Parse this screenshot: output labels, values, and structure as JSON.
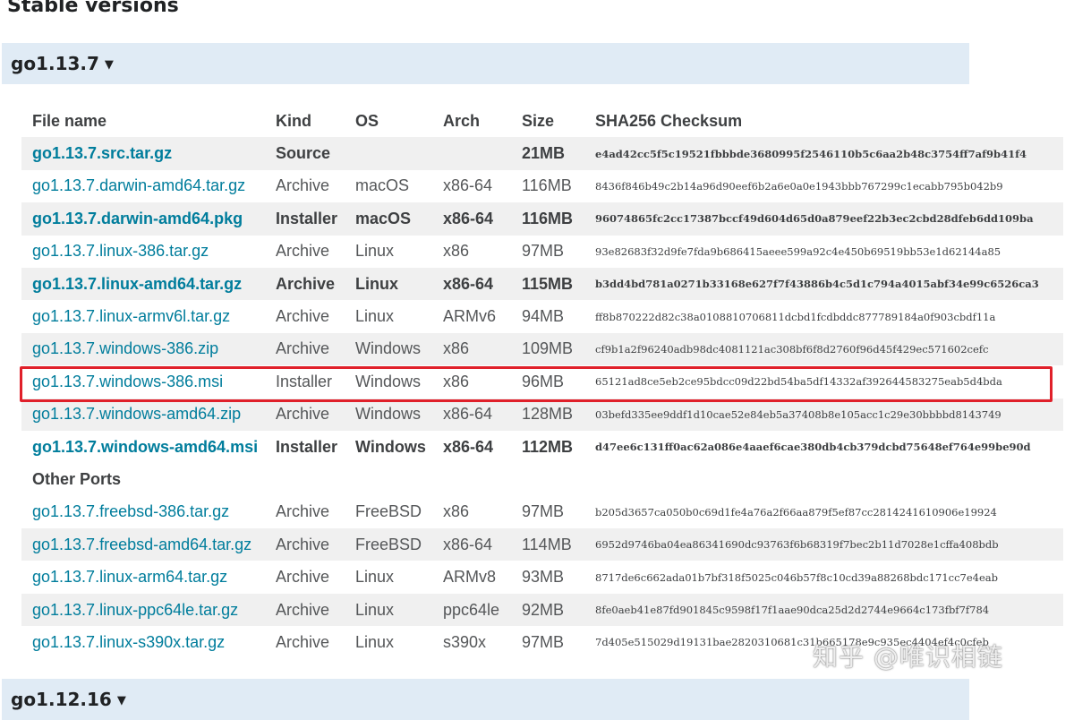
{
  "page": {
    "heading": "Stable versions"
  },
  "versions": [
    {
      "title": "go1.13.7",
      "caret": "▼"
    },
    {
      "title": "go1.12.16",
      "caret": "▼"
    }
  ],
  "table": {
    "headers": [
      "File name",
      "Kind",
      "OS",
      "Arch",
      "Size",
      "SHA256 Checksum"
    ],
    "rows": [
      [
        "go1.13.7.src.tar.gz",
        "Source",
        "",
        "",
        "21MB",
        "e4ad42cc5f5c19521fbbbde3680995f2546110b5c6aa2b48c3754ff7af9b41f4"
      ],
      [
        "go1.13.7.darwin-amd64.tar.gz",
        "Archive",
        "macOS",
        "x86-64",
        "116MB",
        "8436f846b49c2b14a96d90eef6b2a6e0a0e1943bbb767299c1ecabb795b042b9"
      ],
      [
        "go1.13.7.darwin-amd64.pkg",
        "Installer",
        "macOS",
        "x86-64",
        "116MB",
        "96074865fc2cc17387bccf49d604d65d0a879eef22b3ec2cbd28dfeb6dd109ba"
      ],
      [
        "go1.13.7.linux-386.tar.gz",
        "Archive",
        "Linux",
        "x86",
        "97MB",
        "93e82683f32d9fe7fda9b686415aeee599a92c4e450b69519bb53e1d62144a85"
      ],
      [
        "go1.13.7.linux-amd64.tar.gz",
        "Archive",
        "Linux",
        "x86-64",
        "115MB",
        "b3dd4bd781a0271b33168e627f7f43886b4c5d1c794a4015abf34e99c6526ca3"
      ],
      [
        "go1.13.7.linux-armv6l.tar.gz",
        "Archive",
        "Linux",
        "ARMv6",
        "94MB",
        "ff8b870222d82c38a0108810706811dcbd1fcdbddc877789184a0f903cbdf11a"
      ],
      [
        "go1.13.7.windows-386.zip",
        "Archive",
        "Windows",
        "x86",
        "109MB",
        "cf9b1a2f96240adb98dc4081121ac308bf6f8d2760f96d45f429ec571602cefc"
      ],
      [
        "go1.13.7.windows-386.msi",
        "Installer",
        "Windows",
        "x86",
        "96MB",
        "65121ad8ce5eb2ce95bdcc09d22bd54ba5df14332af392644583275eab5d4bda"
      ],
      [
        "go1.13.7.windows-amd64.zip",
        "Archive",
        "Windows",
        "x86-64",
        "128MB",
        "03befd335ee9ddf1d10cae52e84eb5a37408b8e105acc1c29e30bbbbd8143749"
      ],
      [
        "go1.13.7.windows-amd64.msi",
        "Installer",
        "Windows",
        "x86-64",
        "112MB",
        "d47ee6c131ff0ac62a086e4aaef6cae380db4cb379dcbd75648ef764e99be90d"
      ]
    ],
    "other_ports_label": "Other Ports",
    "other_rows": [
      [
        "go1.13.7.freebsd-386.tar.gz",
        "Archive",
        "FreeBSD",
        "x86",
        "97MB",
        "b205d3657ca050b0c69d1fe4a76a2f66aa879f5ef87cc2814241610906e19924"
      ],
      [
        "go1.13.7.freebsd-amd64.tar.gz",
        "Archive",
        "FreeBSD",
        "x86-64",
        "114MB",
        "6952d9746ba04ea86341690dc93763f6b68319f7bec2b11d7028e1cffa408bdb"
      ],
      [
        "go1.13.7.linux-arm64.tar.gz",
        "Archive",
        "Linux",
        "ARMv8",
        "93MB",
        "8717de6c662ada01b7bf318f5025c046b57f8c10cd39a88268bdc171cc7e4eab"
      ],
      [
        "go1.13.7.linux-ppc64le.tar.gz",
        "Archive",
        "Linux",
        "ppc64le",
        "92MB",
        "8fe0aeb41e87fd901845c9598f17f1aae90dca25d2d2744e9664c173fbf7f784"
      ],
      [
        "go1.13.7.linux-s390x.tar.gz",
        "Archive",
        "Linux",
        "s390x",
        "97MB",
        "7d405e515029d19131bae2820310681c31b665178e9c935ec4404ef4c0cfeb"
      ]
    ]
  },
  "watermark": "知乎 @唯识相链",
  "colors": {
    "link": "#007d9c",
    "header_bg": "#e0ebf5",
    "highlight": "#e0202a",
    "row_alt": "#f0f0f0"
  }
}
